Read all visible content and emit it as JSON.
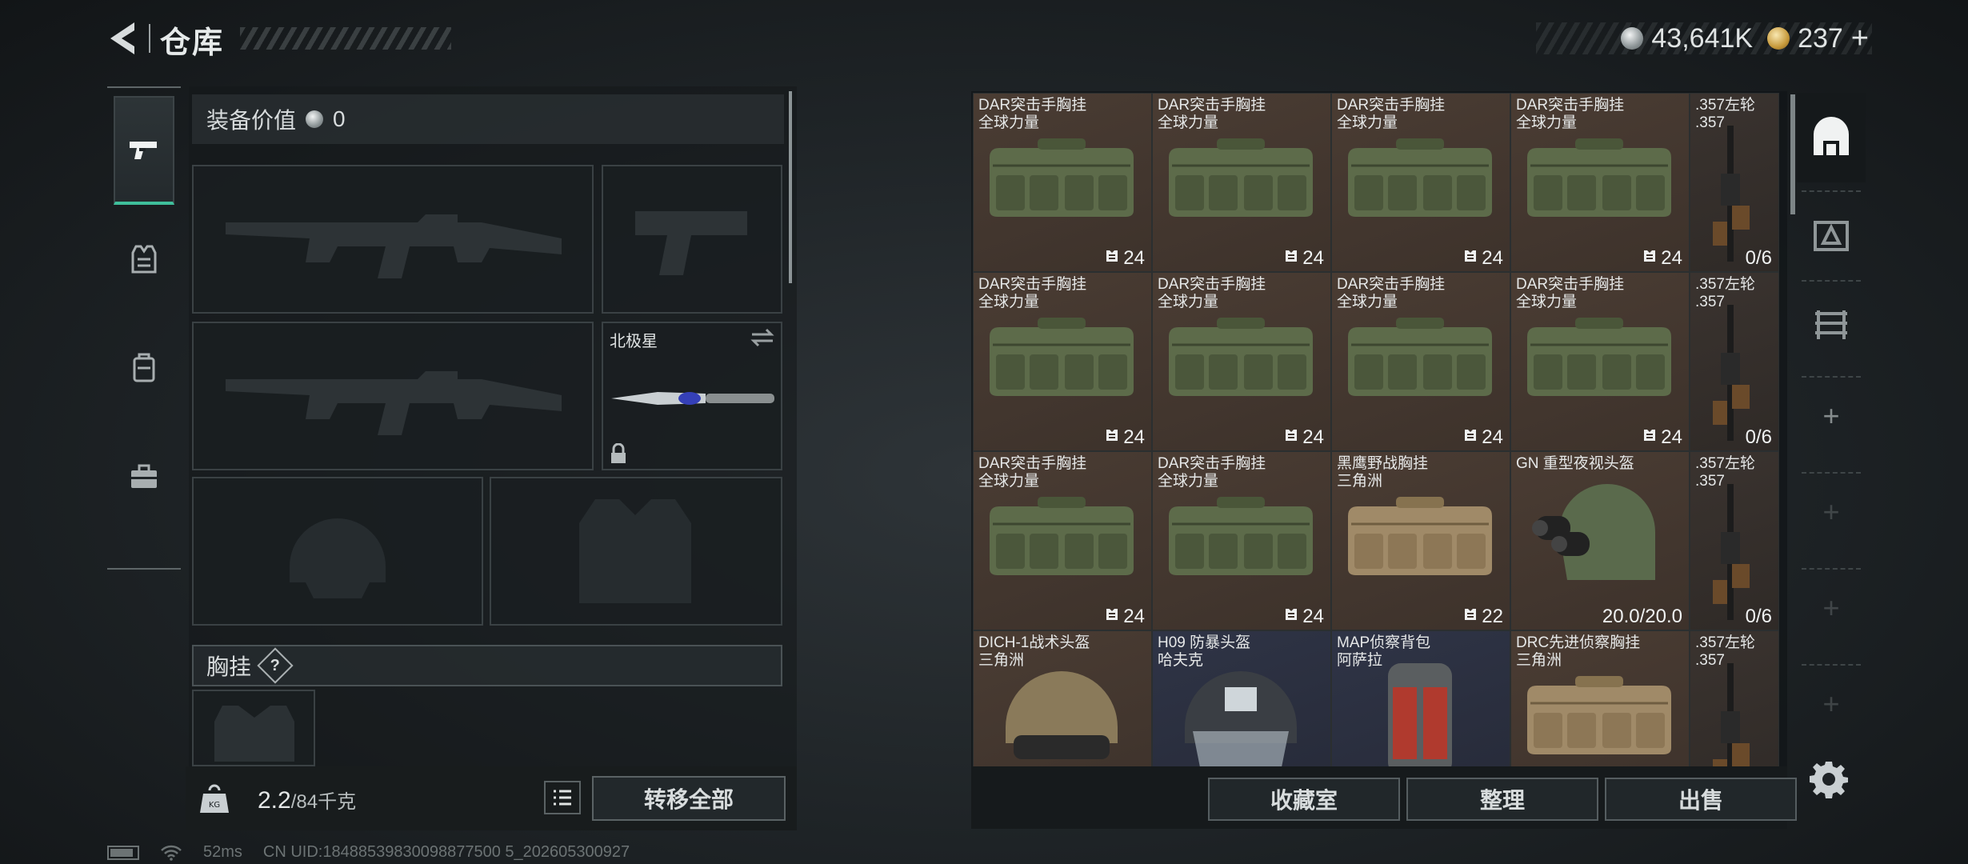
{
  "header": {
    "title": "仓库",
    "currency_silver": "43,641K",
    "currency_gold": "237",
    "gold_plus": "+"
  },
  "equipment": {
    "value_label": "装备价值",
    "value": "0",
    "melee_slot_label": "北极星",
    "chest_rig_label": "胸挂",
    "help_label": "?"
  },
  "bottom": {
    "weight_current": "2.2",
    "weight_max": "/84千克",
    "transfer_all": "转移全部"
  },
  "status": {
    "ping": "52ms",
    "uid": "CN UID:18488539830098877500 5_202605300927"
  },
  "inventory": {
    "rows": [
      [
        {
          "name": "DAR突击手胸挂",
          "sub": "全球力量",
          "count": "24",
          "kind": "bag-green"
        },
        {
          "name": "DAR突击手胸挂",
          "sub": "全球力量",
          "count": "24",
          "kind": "bag-green"
        },
        {
          "name": "DAR突击手胸挂",
          "sub": "全球力量",
          "count": "24",
          "kind": "bag-green"
        },
        {
          "name": "DAR突击手胸挂",
          "sub": "全球力量",
          "count": "24",
          "kind": "bag-green"
        },
        {
          "name": ".357左轮",
          "sub": ".357",
          "count": "0/6",
          "kind": "rifle"
        }
      ],
      [
        {
          "name": "DAR突击手胸挂",
          "sub": "全球力量",
          "count": "24",
          "kind": "bag-green"
        },
        {
          "name": "DAR突击手胸挂",
          "sub": "全球力量",
          "count": "24",
          "kind": "bag-green"
        },
        {
          "name": "DAR突击手胸挂",
          "sub": "全球力量",
          "count": "24",
          "kind": "bag-green"
        },
        {
          "name": "DAR突击手胸挂",
          "sub": "全球力量",
          "count": "24",
          "kind": "bag-green"
        },
        {
          "name": ".357左轮",
          "sub": ".357",
          "count": "0/6",
          "kind": "rifle"
        }
      ],
      [
        {
          "name": "DAR突击手胸挂",
          "sub": "全球力量",
          "count": "24",
          "kind": "bag-green"
        },
        {
          "name": "DAR突击手胸挂",
          "sub": "全球力量",
          "count": "24",
          "kind": "bag-green"
        },
        {
          "name": "黑鹰野战胸挂",
          "sub": "三角洲",
          "count": "22",
          "kind": "bag-tan"
        },
        {
          "name": "GN 重型夜视头盔",
          "sub": "",
          "count": "20.0/20.0",
          "kind": "nv-helmet"
        },
        {
          "name": ".357左轮",
          "sub": ".357",
          "count": "0/6",
          "kind": "rifle"
        }
      ],
      [
        {
          "name": "DICH-1战术头盔",
          "sub": "三角洲",
          "count": "",
          "kind": "helmet-tan"
        },
        {
          "name": "H09 防暴头盔",
          "sub": "哈夫克",
          "count": "",
          "kind": "helmet-riot"
        },
        {
          "name": "MAP侦察背包",
          "sub": "阿萨拉",
          "count": "",
          "kind": "backpack"
        },
        {
          "name": "DRC先进侦察胸挂",
          "sub": "三角洲",
          "count": "",
          "kind": "bag-tan"
        },
        {
          "name": ".357左轮",
          "sub": ".357",
          "count": "",
          "kind": "rifle"
        }
      ]
    ],
    "buttons": {
      "collection": "收藏室",
      "sort": "整理",
      "sell": "出售"
    }
  },
  "colors": {
    "accent": "#3fbf9b",
    "item_bg_brown": "#4a3c33",
    "item_bg_blue": "#2f3446"
  }
}
